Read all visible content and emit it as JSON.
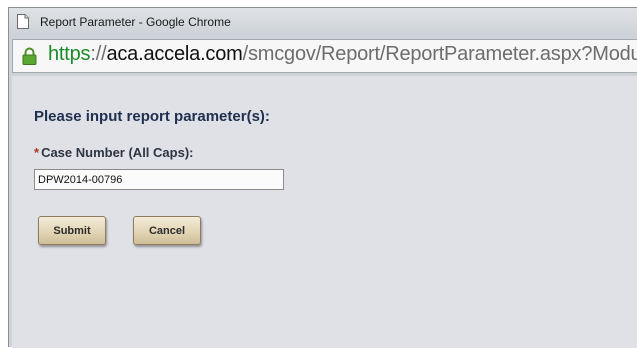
{
  "window": {
    "title": "Report Parameter - Google Chrome"
  },
  "address_bar": {
    "scheme": "https",
    "separator": "://",
    "host": "aca.accela.com",
    "path": "/smcgov/Report/ReportParameter.aspx?Modul",
    "secure_icon": "lock-icon",
    "scheme_color": "#1c8a2a"
  },
  "form": {
    "heading": "Please input report parameter(s):",
    "fields": [
      {
        "required_marker": "*",
        "label": "Case Number (All Caps):",
        "value": "DPW2014-00796"
      }
    ],
    "submit_label": "Submit",
    "cancel_label": "Cancel"
  },
  "colors": {
    "button_fill": "#e1d3b2",
    "heading_text": "#1f2f4f",
    "required_marker": "#a53a23",
    "page_background": "#dfe1e6"
  }
}
